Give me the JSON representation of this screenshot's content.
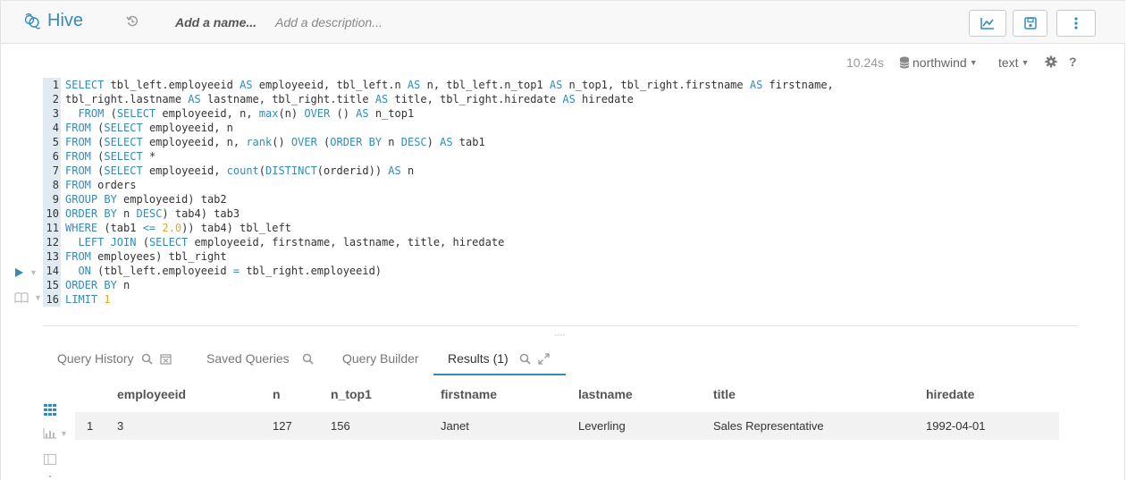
{
  "app": {
    "name": "Hive",
    "name_placeholder": "Add a name...",
    "description_placeholder": "Add a description..."
  },
  "editor": {
    "execution_time": "10.24s",
    "database": "northwind",
    "format": "text",
    "help": "?",
    "lines": [
      [
        [
          "kw",
          "SELECT"
        ],
        [
          "t",
          " tbl_left.employeeid "
        ],
        [
          "kw",
          "AS"
        ],
        [
          "t",
          " employeeid, tbl_left.n "
        ],
        [
          "kw",
          "AS"
        ],
        [
          "t",
          " n, tbl_left.n_top1 "
        ],
        [
          "kw",
          "AS"
        ],
        [
          "t",
          " n_top1, tbl_right.firstname "
        ],
        [
          "kw",
          "AS"
        ],
        [
          "t",
          " firstname,"
        ]
      ],
      [
        [
          "t",
          "tbl_right.lastname "
        ],
        [
          "kw",
          "AS"
        ],
        [
          "t",
          " lastname, tbl_right.title "
        ],
        [
          "kw",
          "AS"
        ],
        [
          "t",
          " title, tbl_right.hiredate "
        ],
        [
          "kw",
          "AS"
        ],
        [
          "t",
          " hiredate"
        ]
      ],
      [
        [
          "t",
          "  "
        ],
        [
          "kw",
          "FROM"
        ],
        [
          "t",
          " ("
        ],
        [
          "kw",
          "SELECT"
        ],
        [
          "t",
          " employeeid, n, "
        ],
        [
          "fn",
          "max"
        ],
        [
          "t",
          "(n) "
        ],
        [
          "kw",
          "OVER"
        ],
        [
          "t",
          " () "
        ],
        [
          "kw",
          "AS"
        ],
        [
          "t",
          " n_top1"
        ]
      ],
      [
        [
          "kw",
          "FROM"
        ],
        [
          "t",
          " ("
        ],
        [
          "kw",
          "SELECT"
        ],
        [
          "t",
          " employeeid, n"
        ]
      ],
      [
        [
          "kw",
          "FROM"
        ],
        [
          "t",
          " ("
        ],
        [
          "kw",
          "SELECT"
        ],
        [
          "t",
          " employeeid, n, "
        ],
        [
          "fn",
          "rank"
        ],
        [
          "t",
          "() "
        ],
        [
          "kw",
          "OVER"
        ],
        [
          "t",
          " ("
        ],
        [
          "kw",
          "ORDER BY"
        ],
        [
          "t",
          " n "
        ],
        [
          "kw",
          "DESC"
        ],
        [
          "t",
          ") "
        ],
        [
          "kw",
          "AS"
        ],
        [
          "t",
          " tab1"
        ]
      ],
      [
        [
          "kw",
          "FROM"
        ],
        [
          "t",
          " ("
        ],
        [
          "kw",
          "SELECT"
        ],
        [
          "t",
          " *"
        ]
      ],
      [
        [
          "kw",
          "FROM"
        ],
        [
          "t",
          " ("
        ],
        [
          "kw",
          "SELECT"
        ],
        [
          "t",
          " employeeid, "
        ],
        [
          "fn",
          "count"
        ],
        [
          "t",
          "("
        ],
        [
          "kw",
          "DISTINCT"
        ],
        [
          "t",
          "(orderid)) "
        ],
        [
          "kw",
          "AS"
        ],
        [
          "t",
          " n"
        ]
      ],
      [
        [
          "kw",
          "FROM"
        ],
        [
          "t",
          " orders"
        ]
      ],
      [
        [
          "kw",
          "GROUP BY"
        ],
        [
          "t",
          " employeeid) tab2"
        ]
      ],
      [
        [
          "kw",
          "ORDER BY"
        ],
        [
          "t",
          " n "
        ],
        [
          "kw",
          "DESC"
        ],
        [
          "t",
          ") tab4) tab3"
        ]
      ],
      [
        [
          "kw",
          "WHERE"
        ],
        [
          "t",
          " (tab1 "
        ],
        [
          "op",
          "<="
        ],
        [
          "t",
          " "
        ],
        [
          "num",
          "2.0"
        ],
        [
          "t",
          ")) tab4) tbl_left"
        ]
      ],
      [
        [
          "t",
          "  "
        ],
        [
          "kw",
          "LEFT JOIN"
        ],
        [
          "t",
          " ("
        ],
        [
          "kw",
          "SELECT"
        ],
        [
          "t",
          " employeeid, firstname, lastname, title, hiredate"
        ]
      ],
      [
        [
          "kw",
          "FROM"
        ],
        [
          "t",
          " employees) tbl_right"
        ]
      ],
      [
        [
          "t",
          "  "
        ],
        [
          "kw",
          "ON"
        ],
        [
          "t",
          " (tbl_left.employeeid "
        ],
        [
          "op",
          "="
        ],
        [
          "t",
          " tbl_right.employeeid)"
        ]
      ],
      [
        [
          "kw",
          "ORDER BY"
        ],
        [
          "t",
          " n"
        ]
      ],
      [
        [
          "kw",
          "LIMIT"
        ],
        [
          "t",
          " "
        ],
        [
          "num",
          "1"
        ]
      ]
    ]
  },
  "tabs": [
    {
      "label": "Query History"
    },
    {
      "label": "Saved Queries"
    },
    {
      "label": "Query Builder"
    },
    {
      "label": "Results (1)"
    }
  ],
  "results": {
    "columns": [
      "employeeid",
      "n",
      "n_top1",
      "firstname",
      "lastname",
      "title",
      "hiredate"
    ],
    "rows": [
      {
        "index": "1",
        "cells": [
          "3",
          "127",
          "156",
          "Janet",
          "Leverling",
          "Sales Representative",
          "1992-04-01"
        ]
      }
    ]
  },
  "colors": {
    "accent": "#338bb8",
    "keyword": "#338bb8",
    "number": "#e6a532",
    "gutter": "#dfeaf3"
  }
}
